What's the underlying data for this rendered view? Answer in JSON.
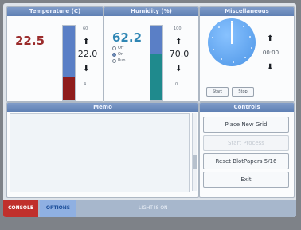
{
  "panels": {
    "temperature": {
      "title": "Temperature (C)",
      "current": "22.5",
      "setpoint": "22.0",
      "max_label": "60",
      "min_label": "4",
      "up_icon": "arrow-up-icon",
      "down_icon": "arrow-down-icon",
      "level_fraction": 0.3,
      "colors": {
        "value": "#9b2c2c",
        "bar_top": "#5a7fc6",
        "bar_fill": "#8f1c1c"
      }
    },
    "humidity": {
      "title": "Humidity (%)",
      "current": "62.2",
      "setpoint": "70.0",
      "max_label": "100",
      "min_label": "0",
      "modes": [
        {
          "label": "Off",
          "selected": false
        },
        {
          "label": "On",
          "selected": true
        },
        {
          "label": "Run",
          "selected": false
        }
      ],
      "level_fraction": 0.62,
      "colors": {
        "value": "#2f86b4",
        "bar_top": "#5a7fc6",
        "bar_fill": "#1f8a8d"
      }
    },
    "misc": {
      "title": "Miscellaneous",
      "timer_display": "00:00",
      "start_label": "Start",
      "stop_label": "Stop",
      "dial_icon": "timer-dial-icon"
    },
    "memo": {
      "title": "Memo"
    },
    "controls": {
      "title": "Controls",
      "buttons": [
        {
          "label": "Place New Grid",
          "enabled": true
        },
        {
          "label": "Start Process",
          "enabled": false
        },
        {
          "label": "Reset BlotPapers 5/16",
          "enabled": true
        },
        {
          "label": "Exit",
          "enabled": true
        }
      ]
    }
  },
  "bottom_bar": {
    "tabs": [
      {
        "label": "CONSOLE",
        "active": true
      },
      {
        "label": "OPTIONS",
        "active": false
      }
    ],
    "status": "LIGHT IS ON"
  }
}
